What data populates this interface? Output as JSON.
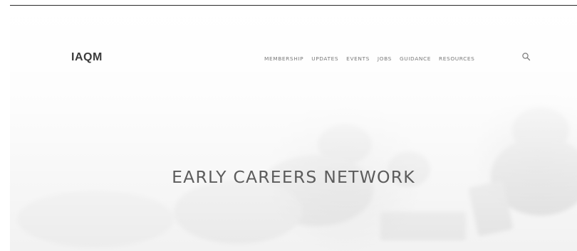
{
  "header": {
    "logo_text": "IAQM"
  },
  "nav": {
    "items": [
      {
        "label": "MEMBERSHIP"
      },
      {
        "label": "UPDATES"
      },
      {
        "label": "EVENTS"
      },
      {
        "label": "JOBS"
      },
      {
        "label": "GUIDANCE"
      },
      {
        "label": "RESOURCES"
      }
    ],
    "search_icon": "search-icon"
  },
  "hero": {
    "title": "EARLY CAREERS NETWORK",
    "background": "faded-greyscale-photo"
  },
  "colors": {
    "logo": "#3b3b3b",
    "nav_text": "#7a7a7a",
    "hero_title": "#5c5c5c",
    "top_rule": "#2a2a2a"
  }
}
